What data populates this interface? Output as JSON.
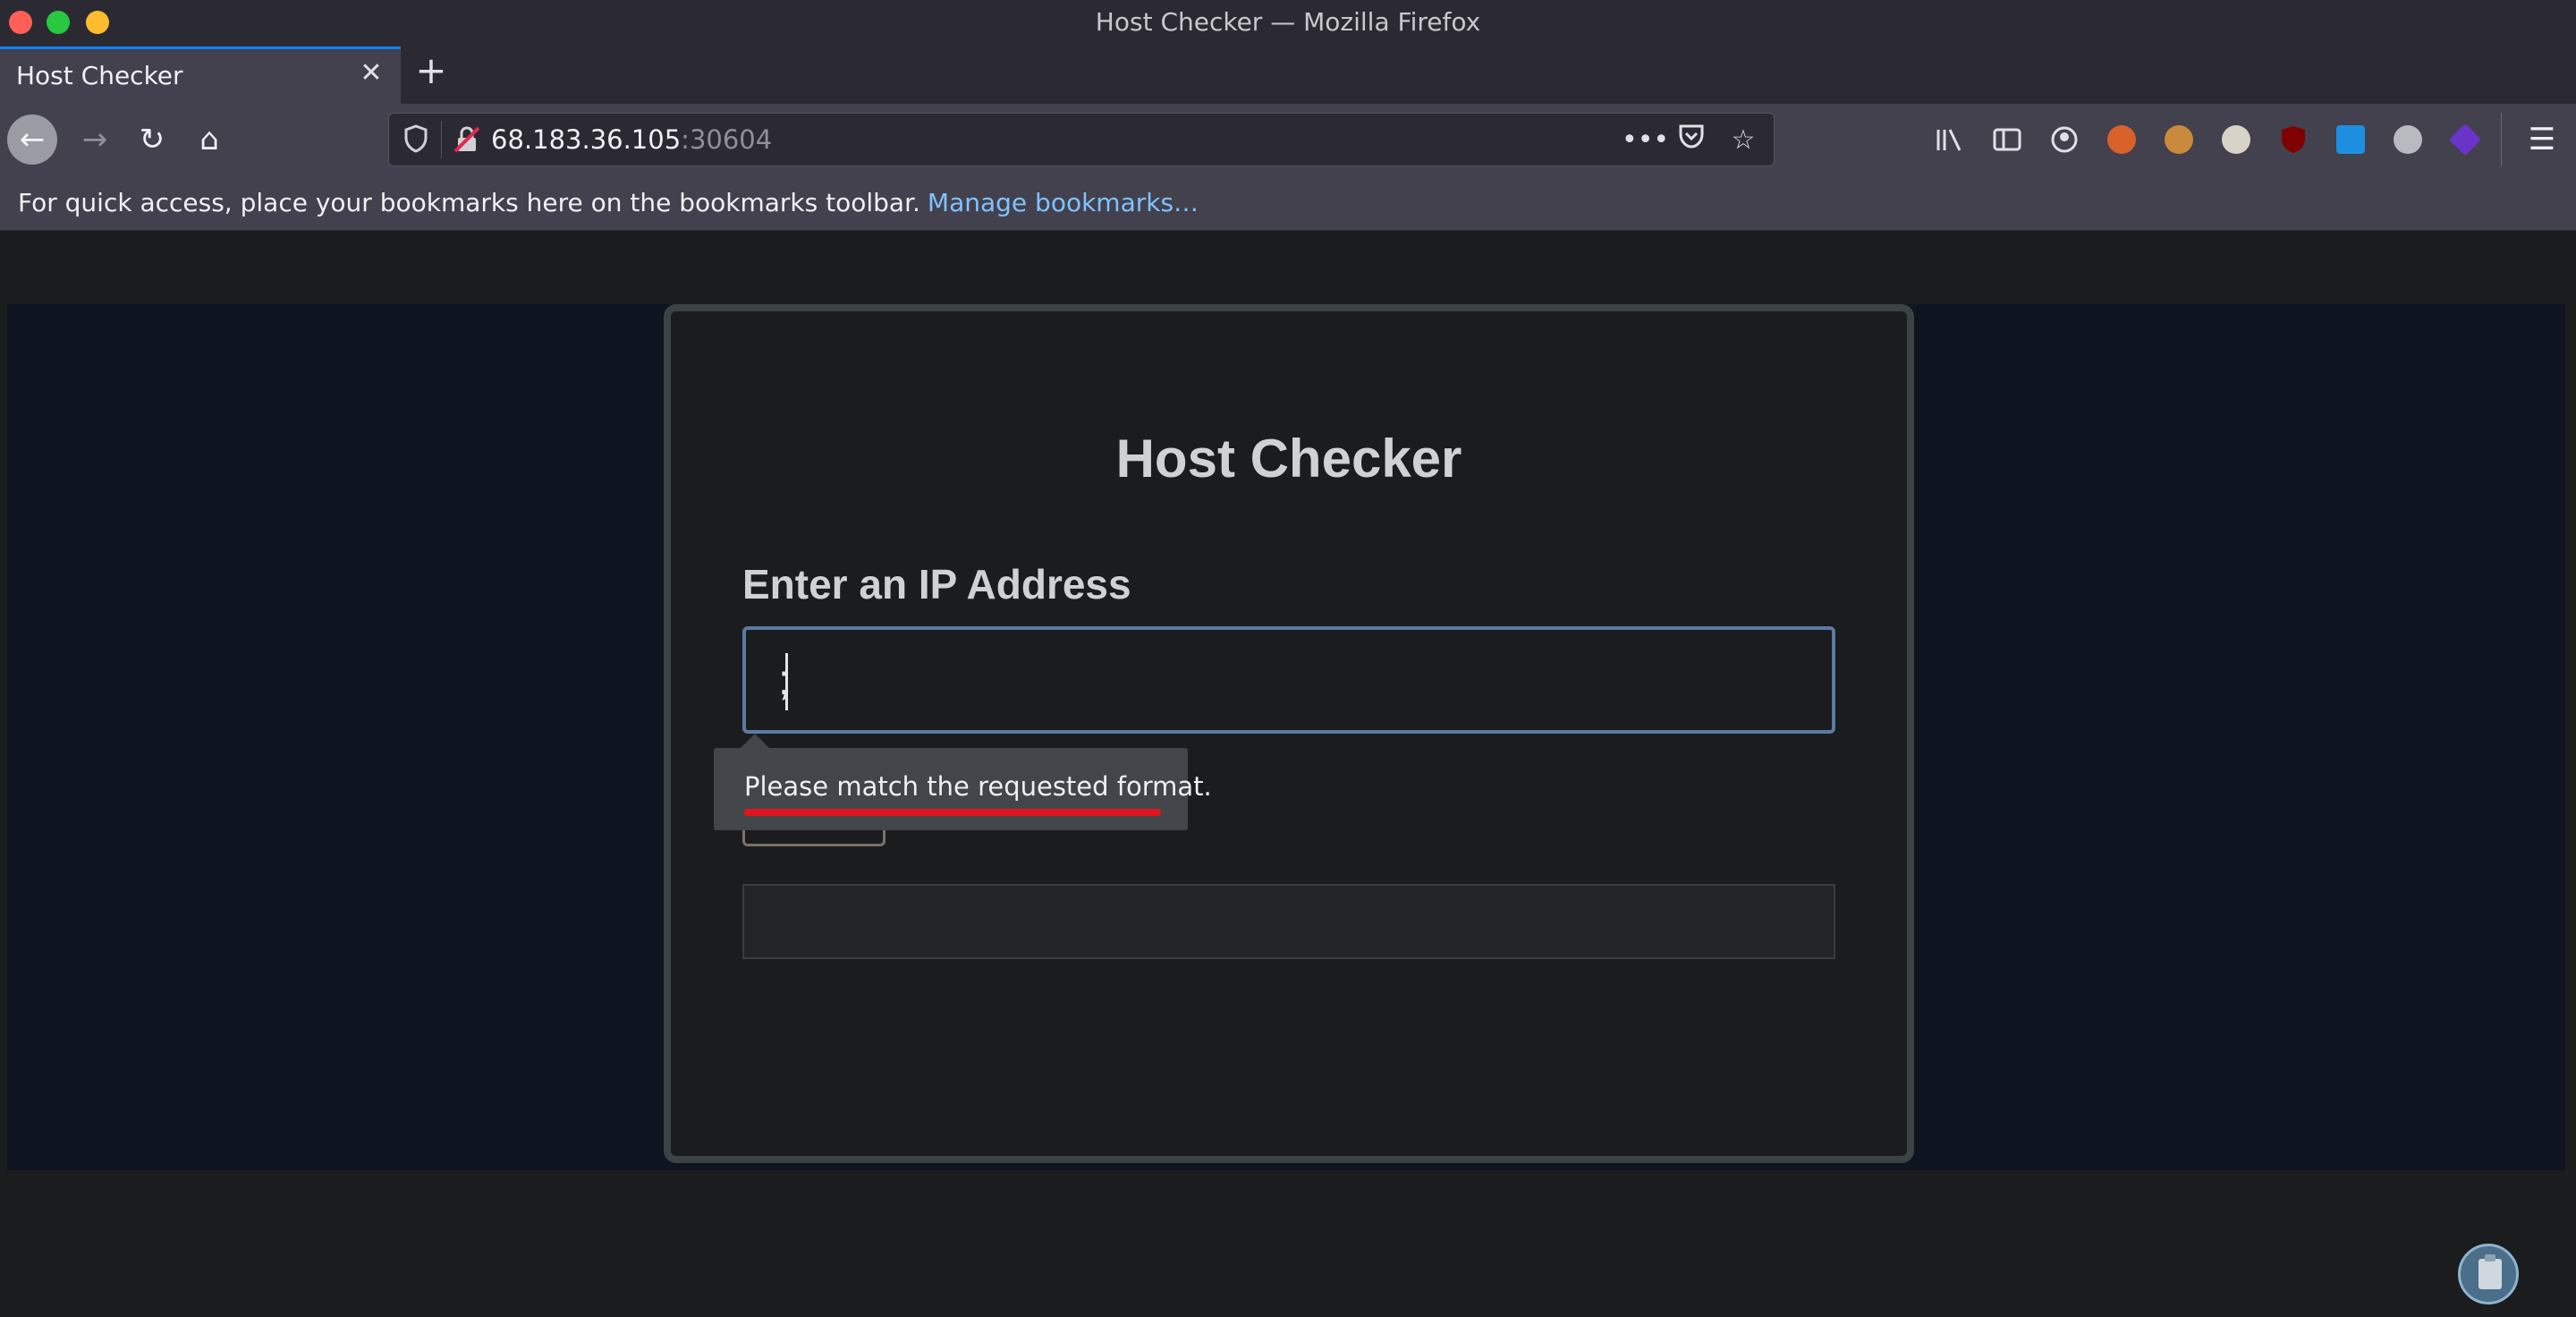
{
  "window": {
    "title": "Host Checker — Mozilla Firefox"
  },
  "tabs": [
    {
      "label": "Host Checker",
      "active": true
    }
  ],
  "navbar": {
    "back_icon": "back-arrow-icon",
    "forward_icon": "forward-arrow-icon",
    "reload_icon": "reload-icon",
    "home_icon": "home-icon",
    "url_host": "68.183.36.105",
    "url_port": ":30604",
    "extensions": [
      "library-icon",
      "sidebar-icon",
      "account-icon",
      "extension-icon-1",
      "cookie-icon",
      "extension-icon-3",
      "ublock-icon",
      "extension-icon-5",
      "extension-icon-6",
      "extension-icon-7"
    ]
  },
  "bookmarks": {
    "hint": "For quick access, place your bookmarks here on the bookmarks toolbar.",
    "manage_link": "Manage bookmarks…"
  },
  "page": {
    "title": "Host Checker",
    "field_label": "Enter an IP Address",
    "ip_value": ";",
    "tooltip": "Please match the requested format.",
    "output": ""
  },
  "colors": {
    "accent": "#0a84ff",
    "link": "#80c2ff",
    "input_border": "#5b7aa3",
    "underline": "#e0141e"
  }
}
